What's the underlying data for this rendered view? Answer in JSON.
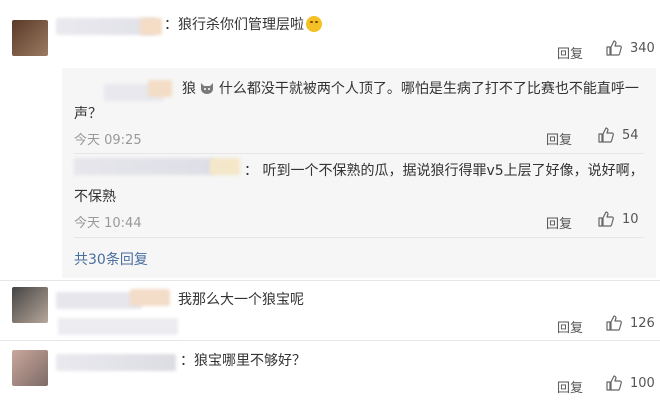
{
  "comments": [
    {
      "text": "：狼行杀你们管理层啦",
      "reply_label": "回复",
      "likes": "340"
    },
    {
      "text": "我那么大一个狼宝呢",
      "reply_label": "回复",
      "likes": "126"
    },
    {
      "text": "：狼宝哪里不够好？",
      "reply_label": "回复",
      "likes": "100"
    }
  ],
  "replies": [
    {
      "text_line1_a": "狼",
      "text_line1_b": "什么都没干就被两个人顶了。哪怕是生病了打不了比赛也不能直呼一",
      "text_line2": "声？",
      "time": "今天 09:25",
      "reply_label": "回复",
      "likes": "54"
    },
    {
      "text_line1": "：  听到一个不保熟的瓜，据说狼行得罪v5上层了好像，说好啊，",
      "text_line2": "不保熟",
      "time": "今天 10:44",
      "reply_label": "回复",
      "likes": "10"
    }
  ],
  "more_replies": "共30条回复",
  "icons": {
    "like": "thumbs-up-icon",
    "wolf": "wolf-emoji-icon",
    "smile": "grinning-emoji-icon"
  }
}
